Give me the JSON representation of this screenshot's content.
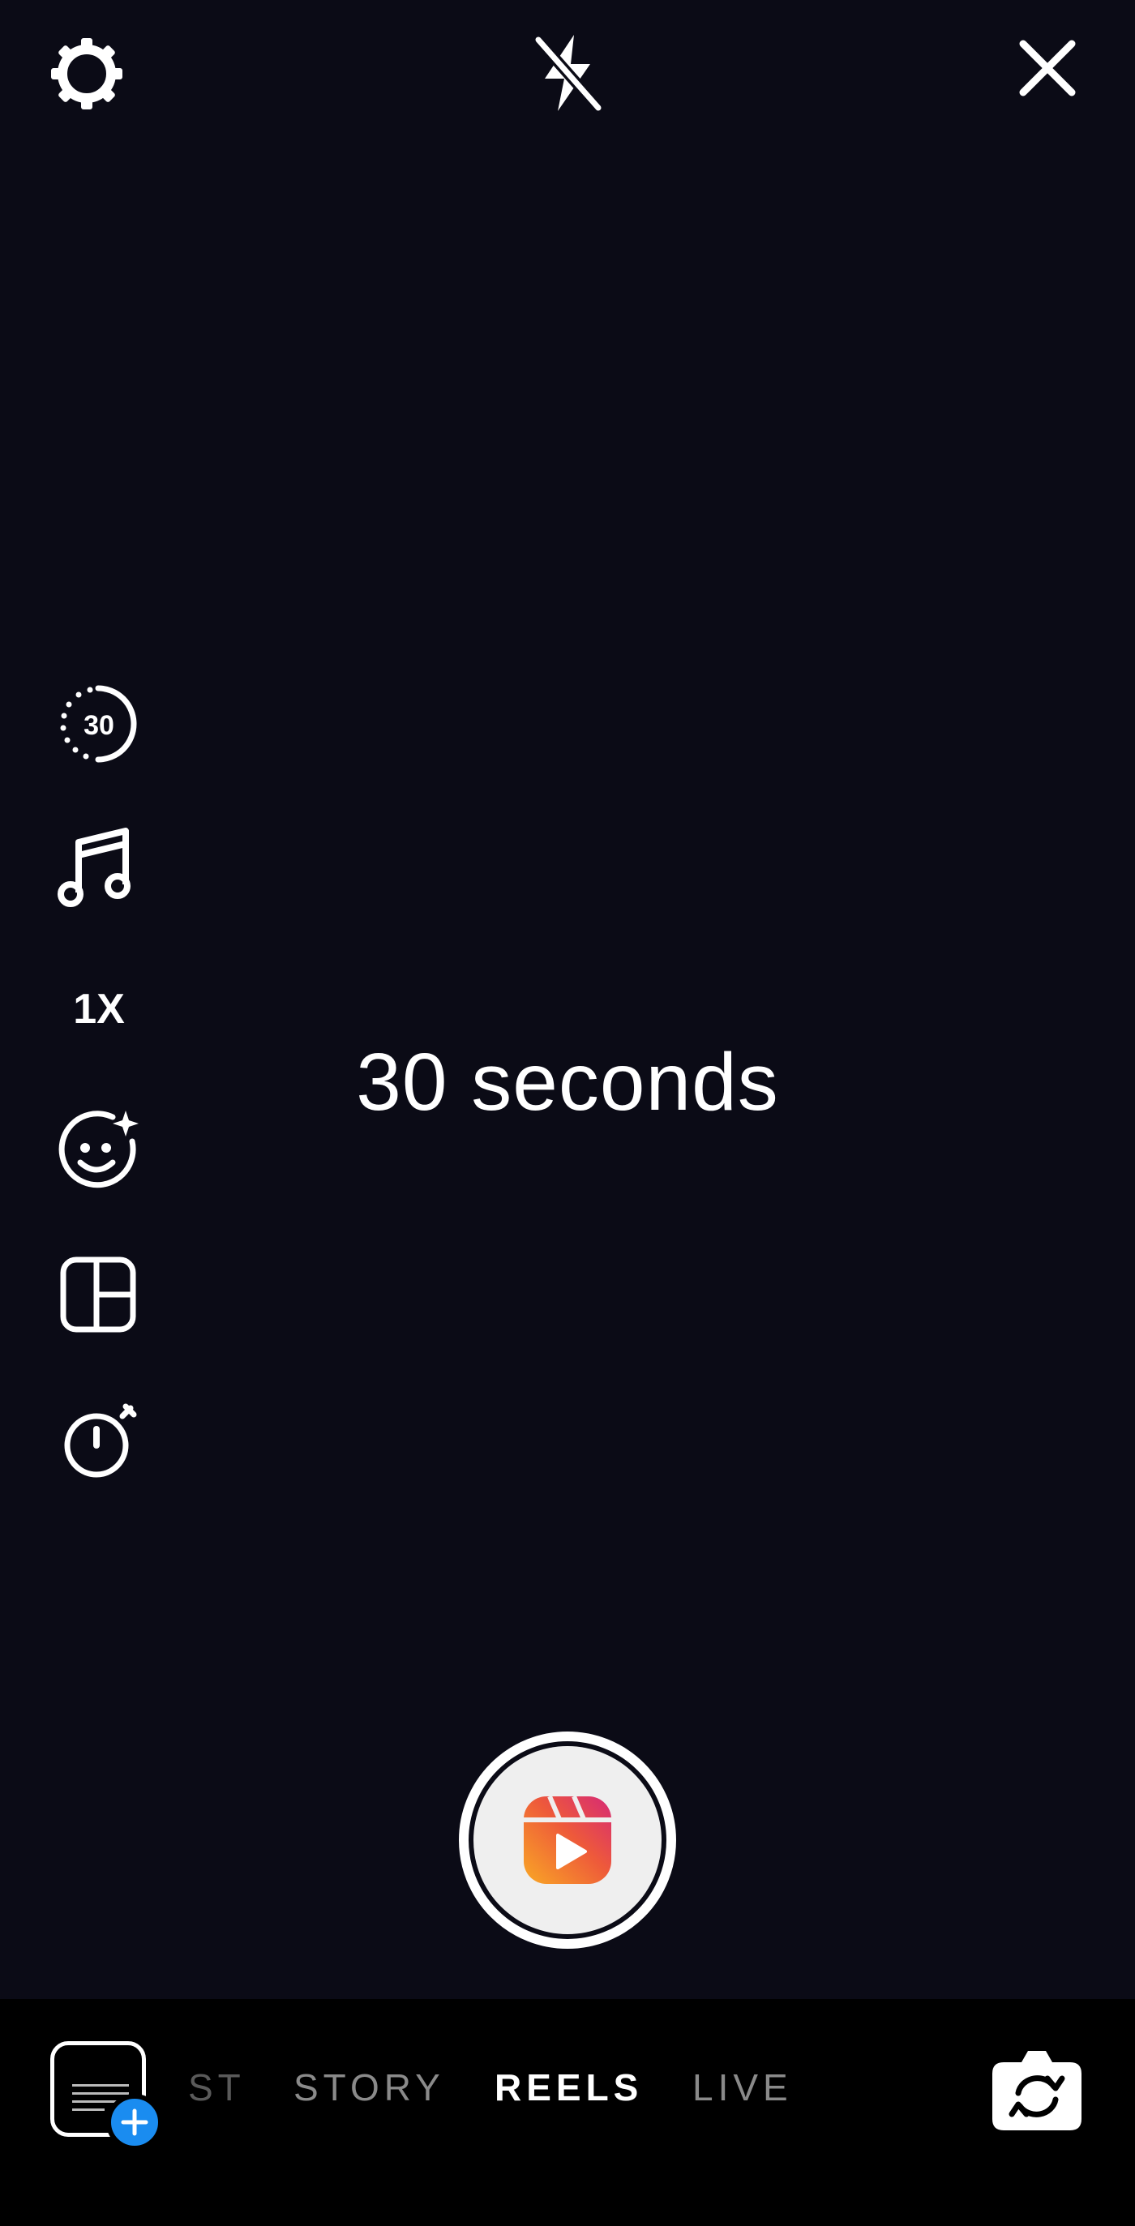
{
  "camera": {
    "duration_text": "30 seconds"
  },
  "toolbar": {
    "timer_length_label": "30",
    "speed_label": "1X"
  },
  "modes": {
    "items": [
      {
        "label": "ST",
        "state": "faded"
      },
      {
        "label": "STORY",
        "state": "dim"
      },
      {
        "label": "REELS",
        "state": "active"
      },
      {
        "label": "LIVE",
        "state": "dim"
      }
    ]
  },
  "icons": {
    "settings": "gear-icon",
    "flash": "flash-off-icon",
    "close": "close-icon",
    "length": "timer-30-icon",
    "audio": "music-note-icon",
    "effects": "face-sparkle-icon",
    "layout": "layout-grid-icon",
    "timer": "stopwatch-icon",
    "shutter": "reels-icon",
    "gallery_add": "plus-icon",
    "flip": "flip-camera-icon"
  },
  "colors": {
    "viewfinder_bg": "#0b0b16",
    "bar_bg": "#000000",
    "gallery_badge": "#1a8cf0",
    "reels_gradient_start": "#f9a825",
    "reels_gradient_end": "#d62976"
  }
}
